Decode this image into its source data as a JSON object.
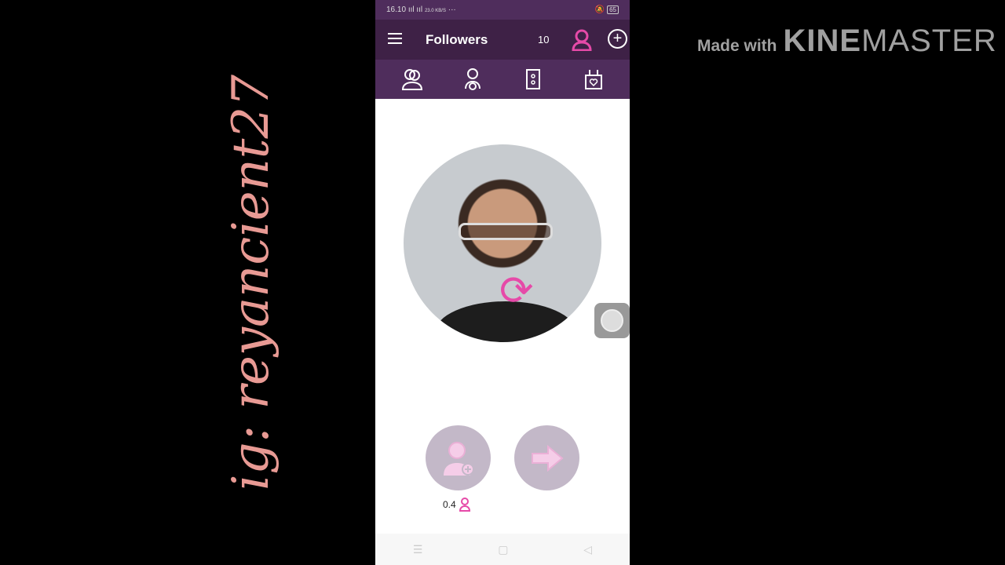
{
  "status_bar": {
    "time": "16.10",
    "signal": "ııl ııl",
    "speed": "23.0 KB/S",
    "more": "···",
    "battery": "65"
  },
  "app_bar": {
    "title": "Followers",
    "count": "10"
  },
  "tabs": [
    {
      "icon": "followers-icon"
    },
    {
      "icon": "vip-user-icon"
    },
    {
      "icon": "door-icon"
    },
    {
      "icon": "shop-bag-icon"
    }
  ],
  "actions": {
    "price": "0.4"
  },
  "colors": {
    "appbar": "#3e2146",
    "tabs": "#4f2d5c",
    "accent": "#e64aa8",
    "button": "#c3b8c8"
  },
  "watermark": {
    "made_with": "Made with",
    "kine": "KINE",
    "master": "MASTER"
  },
  "overlay_text": "ig: reyancient27"
}
